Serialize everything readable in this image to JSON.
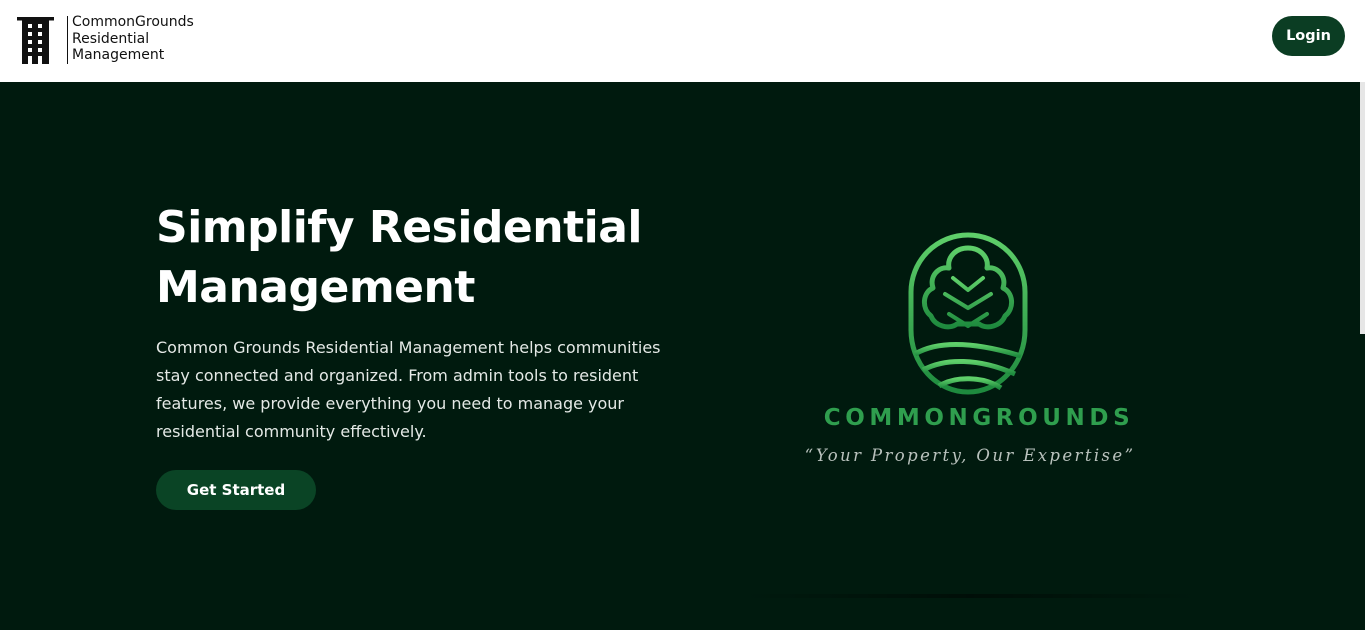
{
  "header": {
    "brand_lines": [
      "CommonGrounds",
      "Residential",
      "Management"
    ],
    "login_label": "Login"
  },
  "hero": {
    "title_line1": "Simplify Residential",
    "title_line2": "Management",
    "description": "Common Grounds Residential Management helps communities stay connected and organized. From admin tools to resident features, we provide everything you need to manage your residential community effectively.",
    "cta_label": "Get Started"
  },
  "logo": {
    "wordmark": "COMMONGROUNDS",
    "tagline": "“Your Property, Our Expertise”",
    "icon": "tree-emblem-icon"
  },
  "colors": {
    "hero_background": "#001a0e",
    "button_green": "#0b3d23",
    "logo_green": "#2f9e4e"
  }
}
